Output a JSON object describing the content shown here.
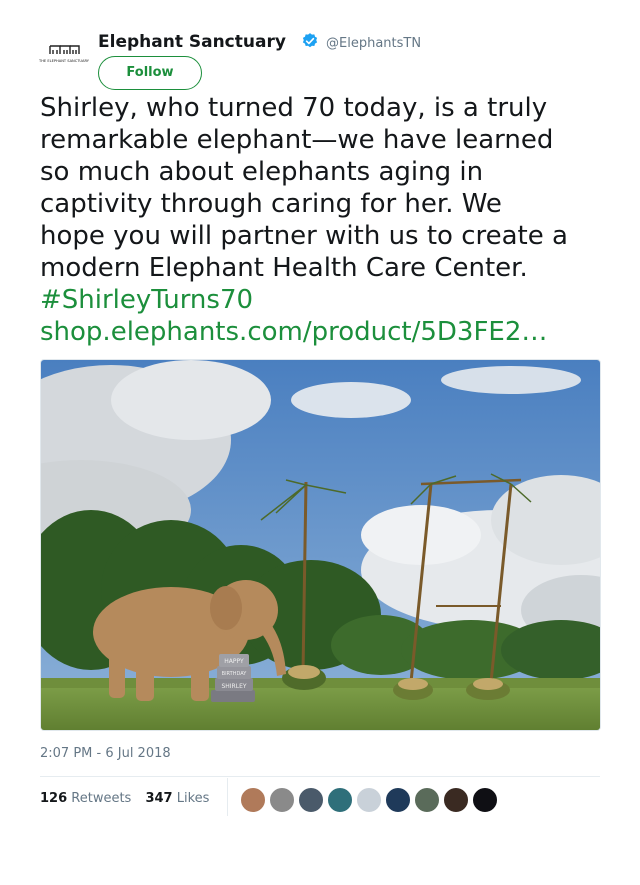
{
  "account": {
    "name": "Elephant Sanctuary",
    "handle": "@ElephantsTN",
    "follow_label": "Follow",
    "logo_text": "THE ELEPHANT SANCTUARY"
  },
  "tweet": {
    "lines": [
      "Shirley, who turned 70 today, is a truly",
      "remarkable elephant—we have learned",
      "so much about elephants aging in",
      "captivity through caring for her. We",
      "hope you will partner with us to create a",
      "modern Elephant Health Care Center."
    ],
    "hashtag": "#ShirleyTurns70",
    "link": "shop.elephants.com/product/5D3FE2…"
  },
  "media": {
    "sign_text": [
      "HAPPY",
      "BIRTHDAY",
      "SHIRLEY"
    ]
  },
  "timestamp": "2:07 PM - 6 Jul 2018",
  "stats": {
    "retweets_count": "126",
    "retweets_label": "Retweets",
    "likes_count": "347",
    "likes_label": "Likes"
  },
  "colors": {
    "accent": "#1c8f3c",
    "verified": "#1da1f2",
    "muted": "#657786"
  },
  "avatars": [
    {
      "color": "#b07a5a"
    },
    {
      "color": "#8a8a8a"
    },
    {
      "color": "#4a5a6a"
    },
    {
      "color": "#2f6f7a"
    },
    {
      "color": "#c9d1d9"
    },
    {
      "color": "#1f3a5a"
    },
    {
      "color": "#5a6b5a"
    },
    {
      "color": "#3a2a22"
    },
    {
      "color": "#0f0f14"
    }
  ]
}
